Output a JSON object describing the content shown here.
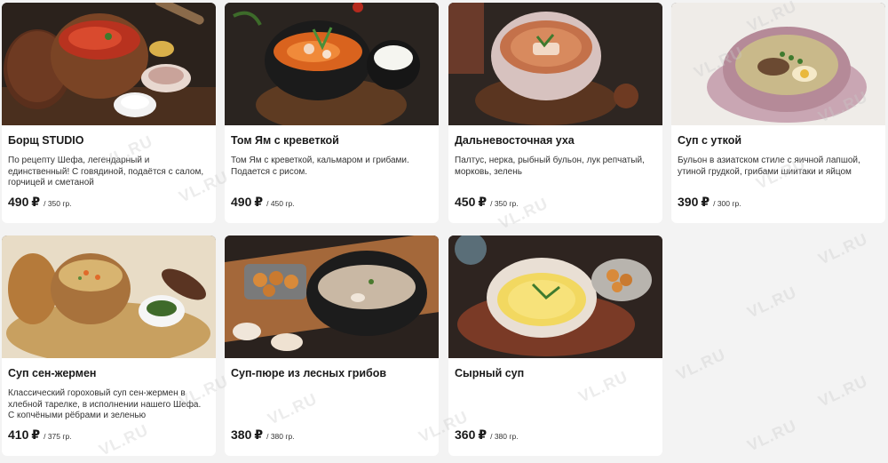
{
  "currency_symbol": "₽",
  "watermark_text": "VL.RU",
  "menu_items": [
    {
      "name": "Борщ STUDIO",
      "description": "По рецепту Шефа, легендарный и единственный! С говядиной, подаётся с салом, горчицей и сметаной",
      "price": "490",
      "weight": "/ 350 гр."
    },
    {
      "name": "Том Ям с креветкой",
      "description": "Том Ям с креветкой, кальмаром и грибами. Подается с рисом.",
      "price": "490",
      "weight": "/ 450 гр."
    },
    {
      "name": "Дальневосточная уха",
      "description": "Палтус, нерка, рыбный бульон, лук репчатый, морковь, зелень",
      "price": "450",
      "weight": "/ 350 гр."
    },
    {
      "name": "Суп с уткой",
      "description": "Бульон в азиатском стиле с яичной лапшой, утиной грудкой, грибами шиитаки и яйцом",
      "price": "390",
      "weight": "/ 300 гр."
    },
    {
      "name": "Суп сен-жермен",
      "description": "Классический гороховый суп сен-жермен в хлебной тарелке, в исполнении нашего Шефа. С копчёными рёбрами и зеленью",
      "price": "410",
      "weight": "/ 375 гр."
    },
    {
      "name": "Суп-пюре из лесных грибов",
      "description": "",
      "price": "380",
      "weight": "/ 380 гр."
    },
    {
      "name": "Сырный суп",
      "description": "",
      "price": "360",
      "weight": "/ 380 гр."
    }
  ]
}
